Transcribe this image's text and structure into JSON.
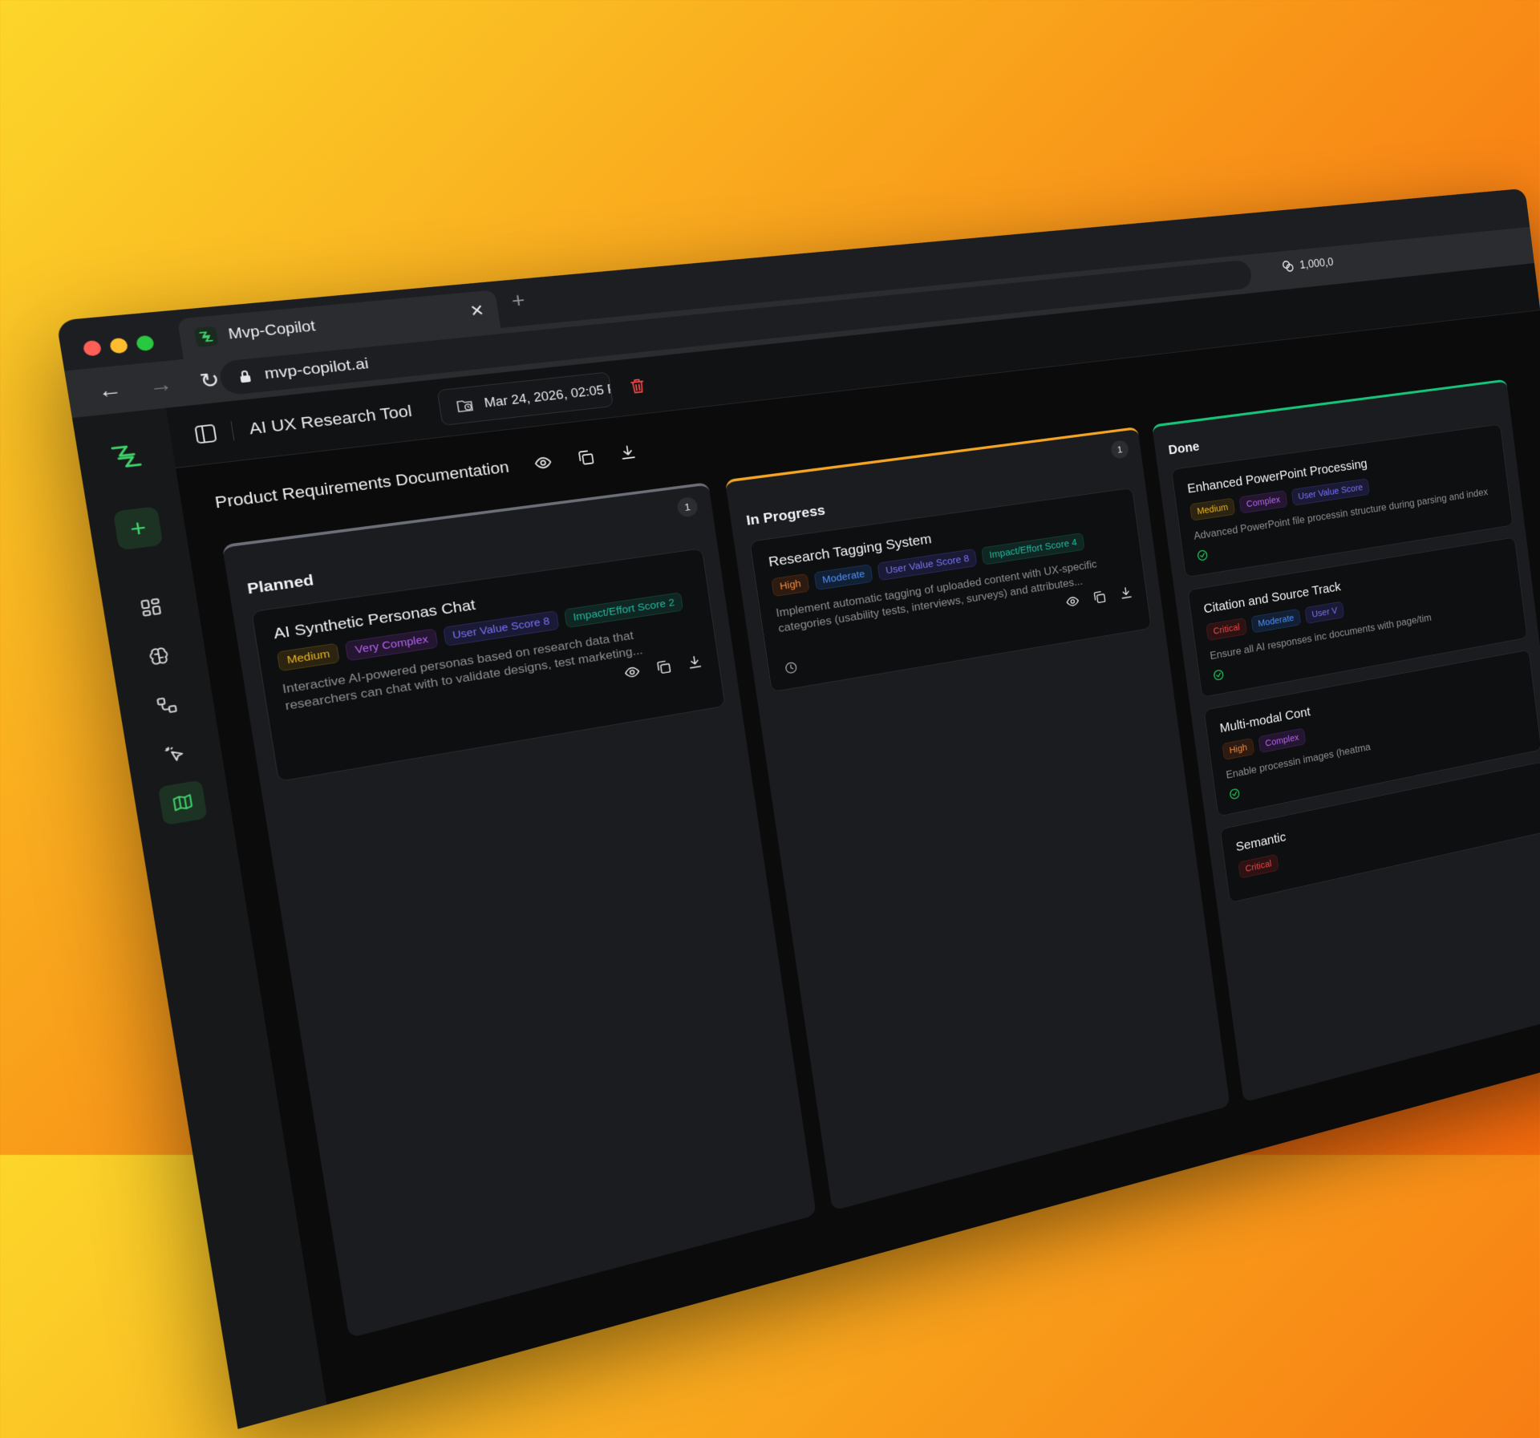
{
  "browser": {
    "tab_title": "Mvp-Copilot",
    "url": "mvp-copilot.ai",
    "extension_text": "1,000,0"
  },
  "toolbar": {
    "project_title": "AI UX Research Tool",
    "version_label": "Mar 24, 2026, 02:05 P"
  },
  "document": {
    "title": "Product Requirements Documentation"
  },
  "columns": [
    {
      "title": "Planned",
      "count": "1",
      "cards": [
        {
          "title": "AI Synthetic Personas Chat",
          "tags": [
            "Medium",
            "Very Complex",
            "User Value Score 8",
            "Impact/Effort Score 2"
          ],
          "description": "Interactive AI-powered personas based on research data that researchers can chat with to validate designs, test marketing..."
        }
      ]
    },
    {
      "title": "In Progress",
      "count": "1",
      "cards": [
        {
          "title": "Research Tagging System",
          "tags": [
            "High",
            "Moderate",
            "User Value Score 8",
            "Impact/Effort Score 4"
          ],
          "description": "Implement automatic tagging of uploaded content with UX-specific categories (usability tests, interviews, surveys) and attributes..."
        }
      ]
    },
    {
      "title": "Done",
      "cards": [
        {
          "title": "Enhanced PowerPoint Processing",
          "tags": [
            "Medium",
            "Complex",
            "User Value Score"
          ],
          "description": "Advanced PowerPoint file processin structure during parsing and index"
        },
        {
          "title": "Citation and Source Track",
          "tags": [
            "Critical",
            "Moderate",
            "User V"
          ],
          "description": "Ensure all AI responses inc documents with page/tim"
        },
        {
          "title": "Multi-modal Cont",
          "tags": [
            "High",
            "Complex"
          ],
          "description": "Enable processin images (heatma"
        },
        {
          "title": "Semantic",
          "tags": [
            "Critical"
          ],
          "description": ""
        }
      ]
    }
  ],
  "colors": {
    "accent_green": "#3fd36a",
    "planned_border": "#6d6f78",
    "progress_border": "#f5a524",
    "done_border": "#17c47a",
    "danger": "#ef4444"
  }
}
